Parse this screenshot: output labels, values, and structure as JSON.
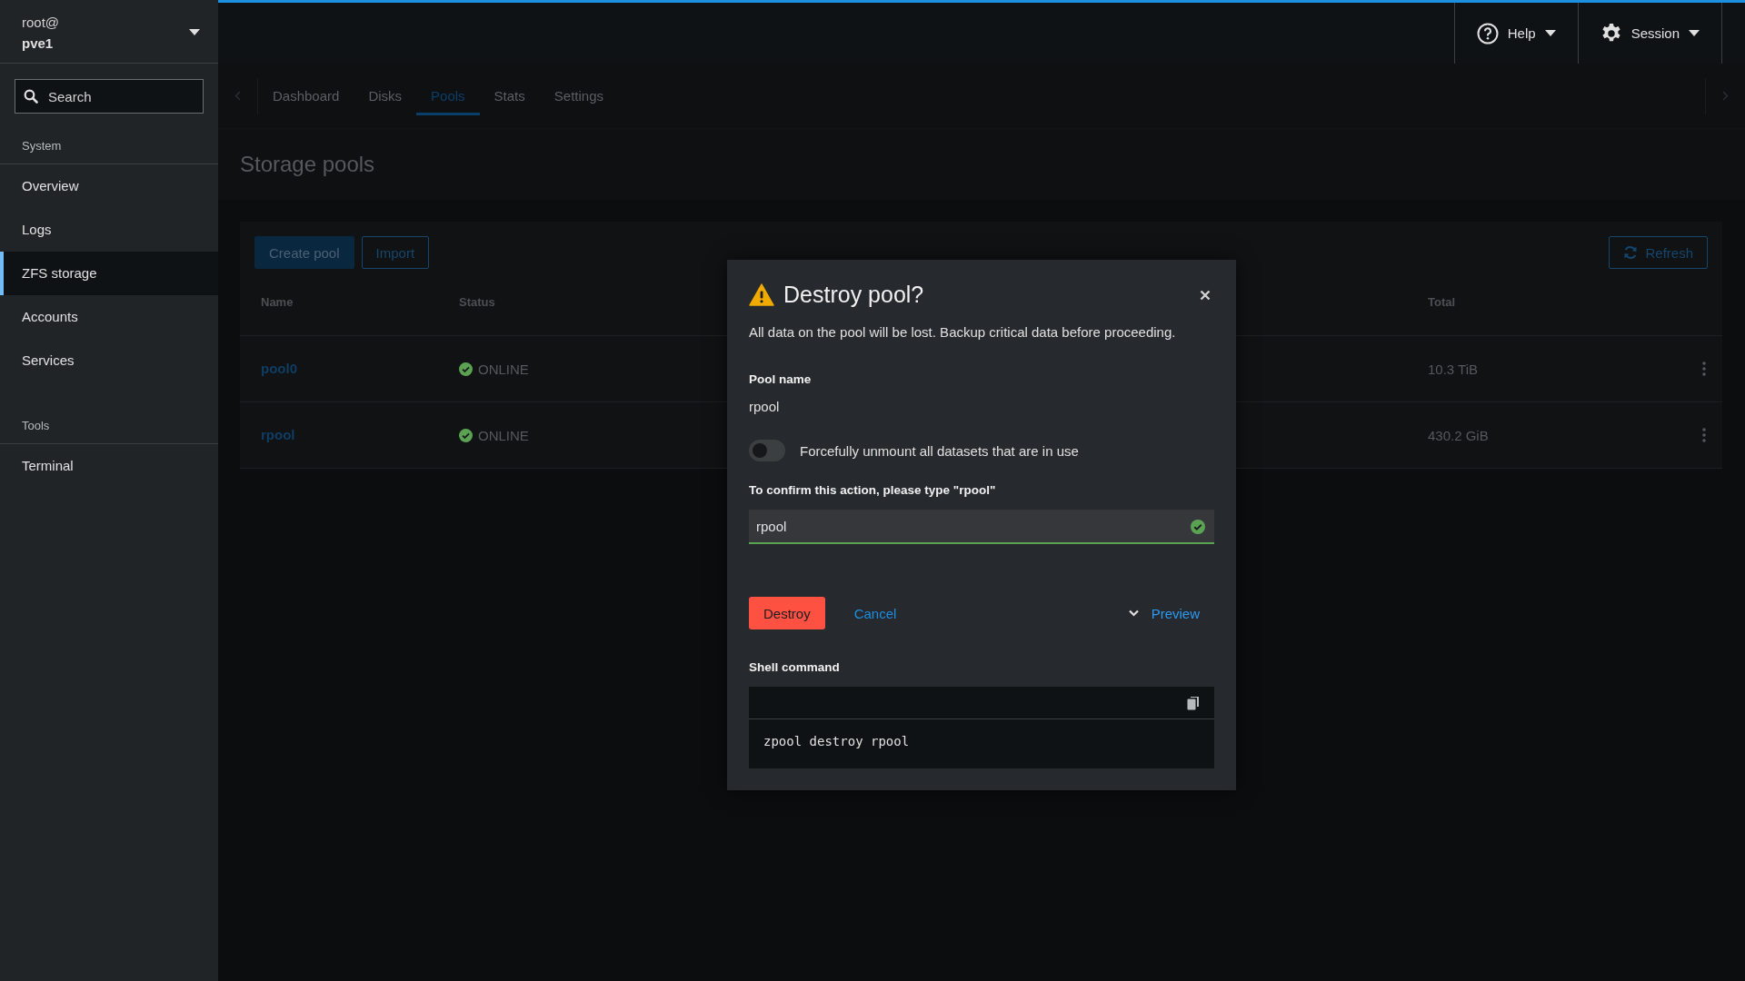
{
  "sidebar": {
    "user": "root@",
    "host": "pve1",
    "search": {
      "placeholder": "Search"
    },
    "sections": [
      {
        "heading": "System",
        "items": [
          {
            "label": "Overview",
            "selected": false
          },
          {
            "label": "Logs",
            "selected": false
          },
          {
            "label": "ZFS storage",
            "selected": true
          },
          {
            "label": "Accounts",
            "selected": false
          },
          {
            "label": "Services",
            "selected": false
          }
        ]
      },
      {
        "heading": "Tools",
        "items": [
          {
            "label": "Terminal",
            "selected": false
          }
        ]
      }
    ]
  },
  "topbar": {
    "menus": [
      {
        "label": "Help",
        "kind": "help"
      },
      {
        "label": "Session",
        "kind": "session"
      }
    ]
  },
  "tabs": [
    {
      "label": "Dashboard",
      "selected": false
    },
    {
      "label": "Disks",
      "selected": false
    },
    {
      "label": "Pools",
      "selected": true
    },
    {
      "label": "Stats",
      "selected": false
    },
    {
      "label": "Settings",
      "selected": false
    }
  ],
  "page_title": "Storage pools",
  "toolbar": {
    "buttons": [
      {
        "label": "Create pool",
        "kind": "primary"
      },
      {
        "label": "Import",
        "kind": "secondary"
      }
    ],
    "refresh": "Refresh"
  },
  "table": {
    "columns": [
      "Name",
      "Status",
      "Total"
    ],
    "rows": [
      {
        "name": "pool0",
        "status": "ONLINE",
        "total": "10.3 TiB"
      },
      {
        "name": "rpool",
        "status": "ONLINE",
        "total": "430.2 GiB"
      }
    ]
  },
  "dialog": {
    "title": "Destroy pool?",
    "message": "All data on the pool will be lost. Backup critical data before proceeding.",
    "pool_label": "Pool name",
    "pool_value": "rpool",
    "toggle": {
      "label": "Forcefully unmount all datasets that are in use",
      "on": false
    },
    "confirm": {
      "label": "To confirm this action, please type \"rpool\"",
      "value": "rpool",
      "valid": true
    },
    "buttons": [
      {
        "label": "Destroy",
        "kind": "danger"
      },
      {
        "label": "Cancel",
        "kind": "link"
      }
    ],
    "preview": {
      "label": "Preview",
      "expanded": true,
      "heading": "Shell command",
      "command": "zpool destroy rpool"
    }
  }
}
